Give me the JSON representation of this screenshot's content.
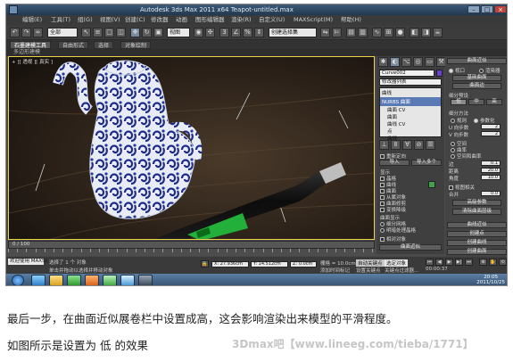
{
  "window": {
    "title": "Autodesk 3ds Max  2011 x64    Teapot-untitled.max"
  },
  "menu": [
    "编辑(E)",
    "工具(T)",
    "组(G)",
    "视图(V)",
    "创建(C)",
    "修改器",
    "动画",
    "图形编辑器",
    "渲染(R)",
    "自定义(U)",
    "MAXScript(M)",
    "帮助(H)"
  ],
  "toolbar": {
    "selection_set": "全部",
    "view_select": "视图",
    "named_set": "创建选择集"
  },
  "ribbon": {
    "tabs": [
      "石墨建模工具",
      "自由形式",
      "选择",
      "对象绘制"
    ],
    "sub_label": "多边形建模"
  },
  "viewport": {
    "label": "+ ][ 透视 ][ 真实 ]"
  },
  "panel": {
    "object_name": "Curve002",
    "modifier_list": "修改器列表",
    "stack_items": [
      "曲线",
      "NURBS 曲面",
      "曲面 CV",
      "曲面",
      "曲线 CV",
      "点",
      "曲线"
    ],
    "selected_stack": "NURBS 曲面",
    "rollouts": [
      "重新定向",
      "导入",
      "导入多个",
      "显示",
      "曲面显示",
      "相对对象",
      "显示曲面",
      "显示",
      "解决"
    ],
    "display_items": [
      "晶格",
      "曲线",
      "曲面",
      "从属对象",
      "曲面修剪",
      "变换降级"
    ],
    "surface_display": [
      "细分网格",
      "明暗处理晶格"
    ],
    "bottom_rollouts": [
      "面近似",
      "曲面近似"
    ]
  },
  "panel2": {
    "title": "曲面近似",
    "radio1": "视口",
    "radio2": "渲染器",
    "group1": "基础曲面",
    "group2": "曲面边",
    "presets_label": "细分预设",
    "levels": [
      "低",
      "中",
      "高"
    ],
    "method_label": "细分方法",
    "methods": [
      "规则",
      "参数化",
      "空间",
      "曲率",
      "空间和曲率"
    ],
    "params": [
      {
        "label": "U 向步数",
        "value": "2"
      },
      {
        "label": "V 向步数",
        "value": "2"
      },
      {
        "label": "边",
        "value": "0.1"
      },
      {
        "label": "距离",
        "value": "20.0"
      },
      {
        "label": "角度",
        "value": "10.0"
      }
    ],
    "check_label": "视图相关",
    "merge_label": "合并",
    "merge_value": "0.0",
    "advanced": "高级参数",
    "clear": "清除曲面层级",
    "sections": [
      "曲线近似",
      "创建点",
      "创建曲线",
      "创建曲面"
    ]
  },
  "timeline": {
    "label": "0 / 100"
  },
  "status": {
    "script": "欢迎使用 MAXSc",
    "selected": "选择了 1 个 对象",
    "prompt": "单击并拖动以选择并移动对象",
    "x": "X: 27.936cm",
    "y": "Y: 14.512cm",
    "z": "Z: 0.0cm",
    "grid": "栅格 = 10.0cm",
    "autokey": "自动关键点",
    "selected_mode": "选定对象",
    "setkey": "设置关键点",
    "filter": "关键点过滤器...",
    "add_tag": "添加时间标记",
    "time": "00:00:37"
  },
  "tray": {
    "time": "20:05",
    "date": "2011/10/25"
  },
  "caption": {
    "line1": "最后一步，在曲面近似展卷栏中设置成高，这会影响渲染出来模型的平滑程度。",
    "line2": "如图所示是设置为 低 的效果"
  },
  "watermark": "3Dmax吧【www.lineeg.com/tieba/1771】"
}
